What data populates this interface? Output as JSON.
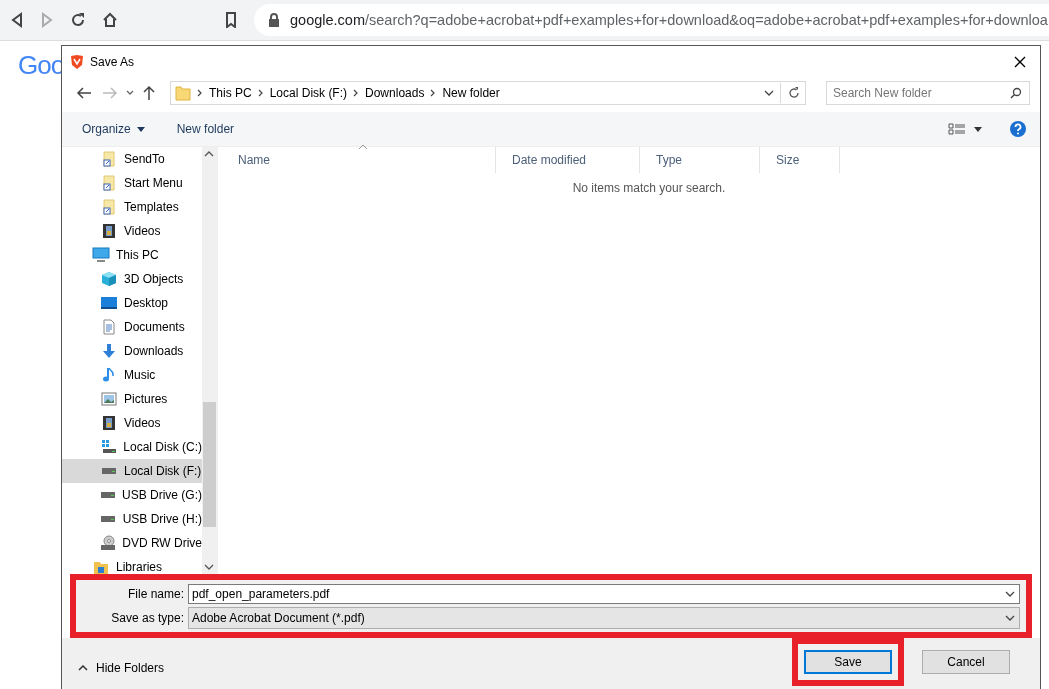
{
  "browser": {
    "url_host": "google.com",
    "url_rest": "/search?q=adobe+acrobat+pdf+examples+for+download&oq=adobe+acrobat+pdf+examples+for+downloa",
    "logo_text": "Goo"
  },
  "dialog": {
    "title": "Save As",
    "breadcrumb": [
      "This PC",
      "Local Disk (F:)",
      "Downloads",
      "New folder"
    ],
    "search": {
      "placeholder": "Search New folder"
    },
    "commands": {
      "organize": "Organize",
      "new_folder": "New folder"
    },
    "nav_tree": [
      {
        "children": [
          {
            "label": "SendTo",
            "kind": "shortcut",
            "selected": false
          },
          {
            "label": "Start Menu",
            "kind": "shortcut",
            "selected": false
          },
          {
            "label": "Templates",
            "kind": "shortcut",
            "selected": false
          },
          {
            "label": "Videos",
            "kind": "video",
            "selected": false
          }
        ]
      },
      {
        "label": "This PC",
        "kind": "pc",
        "selected": false,
        "children": [
          {
            "label": "3D Objects",
            "kind": "cube",
            "selected": false
          },
          {
            "label": "Desktop",
            "kind": "desktop",
            "selected": false
          },
          {
            "label": "Documents",
            "kind": "document",
            "selected": false
          },
          {
            "label": "Downloads",
            "kind": "download",
            "selected": false
          },
          {
            "label": "Music",
            "kind": "music",
            "selected": false
          },
          {
            "label": "Pictures",
            "kind": "picture",
            "selected": false
          },
          {
            "label": "Videos",
            "kind": "video",
            "selected": false
          },
          {
            "label": "Local Disk (C:)",
            "kind": "sysdisk",
            "selected": false
          },
          {
            "label": "Local Disk (F:)",
            "kind": "disk",
            "selected": true
          },
          {
            "label": "USB Drive (G:)",
            "kind": "disk",
            "selected": false
          },
          {
            "label": "USB Drive (H:)",
            "kind": "disk",
            "selected": false
          },
          {
            "label": "DVD RW Drive",
            "kind": "dvd",
            "selected": false
          }
        ]
      },
      {
        "label": "Libraries",
        "kind": "library",
        "selected": false
      }
    ],
    "columns": [
      "Name",
      "Date modified",
      "Type",
      "Size"
    ],
    "empty_message": "No items match your search.",
    "file_name": {
      "label": "File name:",
      "value": "pdf_open_parameters.pdf"
    },
    "save_type": {
      "label": "Save as type:",
      "value": "Adobe Acrobat Document (*.pdf)"
    },
    "hide_folders": "Hide Folders",
    "buttons": [
      {
        "label": "Save",
        "kind": "default",
        "highlighted": true
      },
      {
        "label": "Cancel",
        "kind": "normal",
        "highlighted": false
      }
    ],
    "fields_highlighted": true
  }
}
